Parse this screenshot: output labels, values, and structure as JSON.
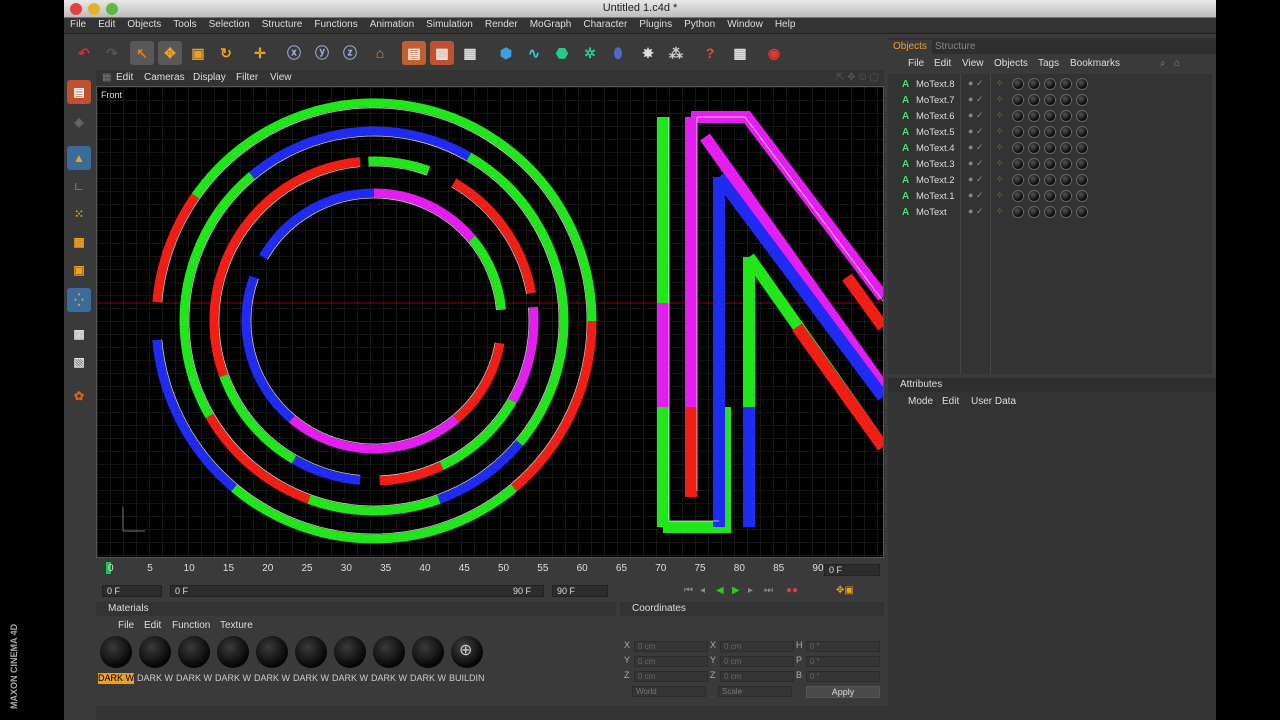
{
  "window": {
    "title": "Untitled 1.c4d *"
  },
  "menubar": [
    "File",
    "Edit",
    "Objects",
    "Tools",
    "Selection",
    "Structure",
    "Functions",
    "Animation",
    "Simulation",
    "Render",
    "MoGraph",
    "Character",
    "Plugins",
    "Python",
    "Window",
    "Help"
  ],
  "viewport": {
    "menu": [
      "Edit",
      "Cameras",
      "Display",
      "Filter",
      "View"
    ],
    "label": "Front"
  },
  "timeline": {
    "ticks": [
      "0",
      "5",
      "10",
      "15",
      "20",
      "25",
      "30",
      "35",
      "40",
      "45",
      "50",
      "55",
      "60",
      "65",
      "70",
      "75",
      "80",
      "85",
      "90"
    ],
    "current_frame": "0 F",
    "start_field": "0 F",
    "range_start": "0 F",
    "range_end": "90 F",
    "end_field": "90 F"
  },
  "materials": {
    "title": "Materials",
    "menu": [
      "File",
      "Edit",
      "Function",
      "Texture"
    ],
    "items": [
      "DARK W",
      "DARK W",
      "DARK W",
      "DARK W",
      "DARK W",
      "DARK W",
      "DARK W",
      "DARK W",
      "DARK W",
      "BUILDIN"
    ]
  },
  "coordinates": {
    "title": "Coordinates",
    "rows": [
      {
        "a": "X",
        "av": "0 cm",
        "b": "X",
        "bv": "0 cm",
        "c": "H",
        "cv": "0 °"
      },
      {
        "a": "Y",
        "av": "0 cm",
        "b": "Y",
        "bv": "0 cm",
        "c": "P",
        "cv": "0 °"
      },
      {
        "a": "Z",
        "av": "0 cm",
        "b": "Z",
        "bv": "0 cm",
        "c": "B",
        "cv": "0 °"
      }
    ],
    "mode_left": "World",
    "mode_right": "Scale",
    "apply": "Apply"
  },
  "objects": {
    "tabs": [
      "Objects",
      "Structure"
    ],
    "menu": [
      "File",
      "Edit",
      "View",
      "Objects",
      "Tags",
      "Bookmarks"
    ],
    "rows": [
      "MoText.8",
      "MoText.7",
      "MoText.6",
      "MoText.5",
      "MoText.4",
      "MoText.3",
      "MoText.2",
      "MoText.1",
      "MoText"
    ]
  },
  "attributes": {
    "title": "Attributes",
    "menu": [
      "Mode",
      "Edit",
      "User Data"
    ]
  },
  "brand": "MAXON CINEMA 4D",
  "colors": {
    "green": "#22e61c",
    "blue": "#1f2bf0",
    "red": "#f01e14",
    "magenta": "#e41ef0",
    "active_tab": "#f0a020"
  }
}
